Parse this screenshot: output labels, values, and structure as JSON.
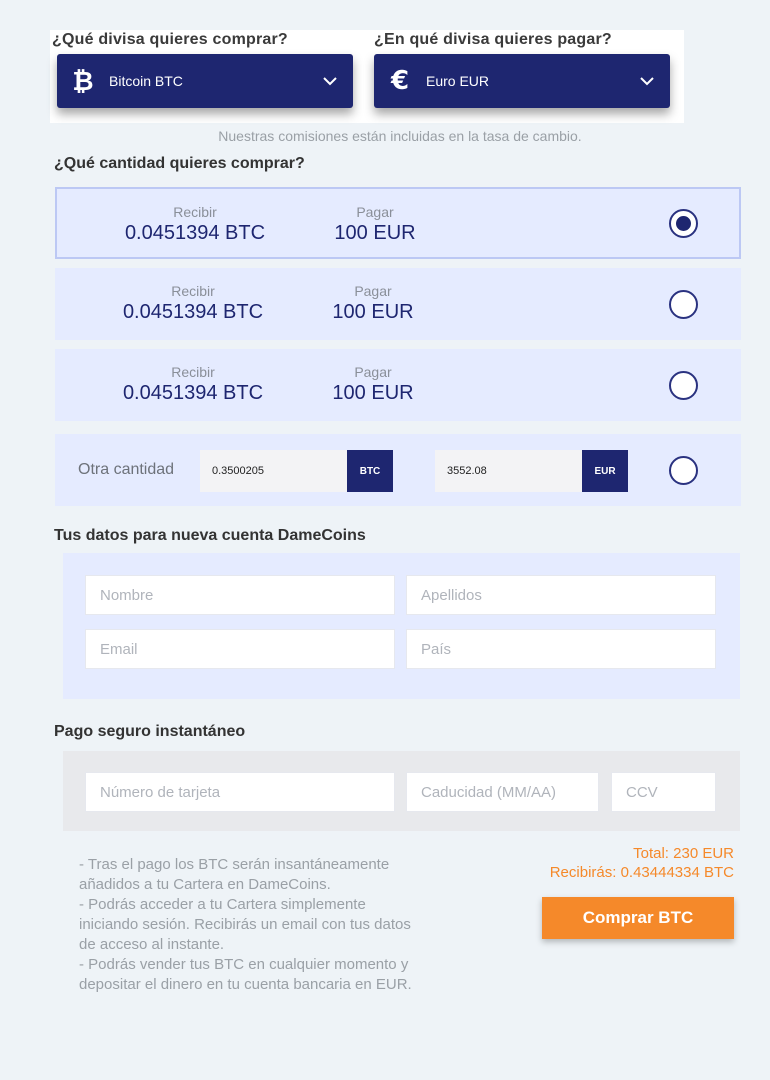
{
  "buy_currency": {
    "question": "¿Qué divisa quieres comprar?",
    "icon": "bitcoin-icon",
    "symbol": "₿",
    "selected": "Bitcoin BTC"
  },
  "pay_currency": {
    "question": "¿En qué divisa quieres pagar?",
    "icon": "euro-icon",
    "symbol": "€",
    "selected": "Euro EUR"
  },
  "fees_note": "Nuestras comisiones están incluidas en la tasa de cambio.",
  "amount_section": {
    "title": "¿Qué cantidad quieres comprar?",
    "options": [
      {
        "receive_label": "Recibir",
        "receive_value": "0.0451394 BTC",
        "pay_label": "Pagar",
        "pay_value": "100 EUR",
        "selected": true
      },
      {
        "receive_label": "Recibir",
        "receive_value": "0.0451394 BTC",
        "pay_label": "Pagar",
        "pay_value": "100 EUR",
        "selected": false
      },
      {
        "receive_label": "Recibir",
        "receive_value": "0.0451394 BTC",
        "pay_label": "Pagar",
        "pay_value": "100 EUR",
        "selected": false
      }
    ],
    "custom": {
      "label": "Otra cantidad",
      "btc_value": "0.3500205",
      "btc_unit": "BTC",
      "eur_value": "3552.08",
      "eur_unit": "EUR",
      "selected": false
    }
  },
  "account_section": {
    "title": "Tus datos para nueva cuenta DameCoins",
    "name_placeholder": "Nombre",
    "surname_placeholder": "Apellidos",
    "email_placeholder": "Email",
    "country_placeholder": "País"
  },
  "payment_section": {
    "title": "Pago seguro instantáneo",
    "card_placeholder": "Número de tarjeta",
    "expiry_placeholder": "Caducidad (MM/AA)",
    "ccv_placeholder": "CCV"
  },
  "info_lines": [
    "- Tras el pago los BTC serán insantáneamente añadidos a tu Cartera en DameCoins.",
    "- Podrás acceder a tu Cartera simplemente iniciando sesión. Recibirás un email con tus datos de acceso al instante.",
    "- Podrás vender tus BTC en cualquier momento y depositar el dinero en tu cuenta bancaria en EUR."
  ],
  "summary": {
    "total": "Total: 230 EUR",
    "receive": "Recibirás: 0.43444334 BTC",
    "buy_button": "Comprar BTC"
  },
  "colors": {
    "navy": "#1e2670",
    "option_bg": "#e5ebff",
    "orange": "#f5892a"
  }
}
